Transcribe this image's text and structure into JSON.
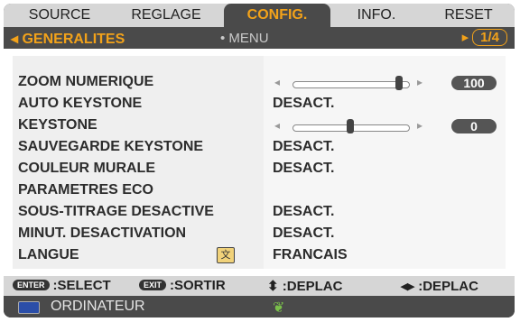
{
  "tabs": [
    "SOURCE",
    "REGLAGE",
    "CONFIG.",
    "INFO.",
    "RESET"
  ],
  "active_tab_index": 2,
  "subheader": {
    "section": "◂ GENERALITES",
    "mid": "• MENU",
    "page": "1/4"
  },
  "rows": [
    {
      "label": "ZOOM NUMERIQUE",
      "type": "slider",
      "value": "100",
      "level": 0.95
    },
    {
      "label": "AUTO KEYSTONE",
      "type": "text",
      "value": "DESACT."
    },
    {
      "label": "KEYSTONE",
      "type": "slider",
      "value": "0",
      "level": 0.5
    },
    {
      "label": "SAUVEGARDE KEYSTONE",
      "type": "text",
      "value": "DESACT."
    },
    {
      "label": "COULEUR MURALE",
      "type": "text",
      "value": "DESACT."
    },
    {
      "label": "PARAMETRES ECO",
      "type": "none",
      "value": ""
    },
    {
      "label": "SOUS-TITRAGE DESACTIVE",
      "type": "text",
      "value": "DESACT."
    },
    {
      "label": "MINUT. DESACTIVATION",
      "type": "text",
      "value": "DESACT."
    },
    {
      "label": "LANGUE",
      "type": "text",
      "value": "FRANCAIS",
      "icon": "language-icon"
    }
  ],
  "footer": [
    {
      "key": "ENTER",
      "label": ":SELECT"
    },
    {
      "key": "EXIT",
      "label": ":SORTIR"
    },
    {
      "key": "⬍",
      "label": ":DEPLAC"
    },
    {
      "key": "◂▸",
      "label": ":DEPLAC"
    }
  ],
  "status": {
    "icon": "computer-input-icon",
    "text": "ORDINATEUR",
    "leaf_icon": "eco-leaf-icon"
  },
  "colors": {
    "accent": "#f2a21a",
    "panel": "#efefef",
    "dark": "#4a4a4a"
  }
}
